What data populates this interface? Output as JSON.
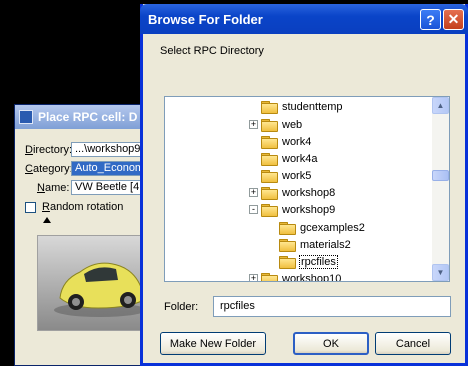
{
  "place_dialog": {
    "title": "Place RPC cell: D",
    "directory_label_u": "D",
    "directory_label_rest": "irectory:",
    "directory_value": "...\\workshop9",
    "category_label_u": "C",
    "category_label_rest": "ategory:",
    "category_value": "Auto_Econom",
    "name_label_u": "N",
    "name_label_rest": "ame:",
    "name_value": "VW Beetle [4",
    "random_rotation_u": "R",
    "random_rotation_rest": "andom rotation"
  },
  "browse_dialog": {
    "title": "Browse For Folder",
    "instruction": "Select RPC Directory",
    "tree": [
      {
        "label": "studenttemp",
        "level": 1,
        "expander": ""
      },
      {
        "label": "web",
        "level": 1,
        "expander": "+"
      },
      {
        "label": "work4",
        "level": 1,
        "expander": ""
      },
      {
        "label": "work4a",
        "level": 1,
        "expander": ""
      },
      {
        "label": "work5",
        "level": 1,
        "expander": ""
      },
      {
        "label": "workshop8",
        "level": 1,
        "expander": "+"
      },
      {
        "label": "workshop9",
        "level": 1,
        "expander": "-"
      },
      {
        "label": "gcexamples2",
        "level": 2,
        "expander": ""
      },
      {
        "label": "materials2",
        "level": 2,
        "expander": ""
      },
      {
        "label": "rpcfiles",
        "level": 2,
        "expander": "",
        "selected": true
      },
      {
        "label": "workshop10",
        "level": 1,
        "expander": "+"
      }
    ],
    "folder_label": "Folder:",
    "folder_value": "rpcfiles",
    "make_new_folder": "Make New Folder",
    "ok": "OK",
    "cancel": "Cancel",
    "help_glyph": "?",
    "close_glyph": "✕"
  },
  "colors": {
    "xp_title_blue": "#0a44c8",
    "selection_blue": "#316ac5",
    "dialog_face": "#ece9d8"
  }
}
